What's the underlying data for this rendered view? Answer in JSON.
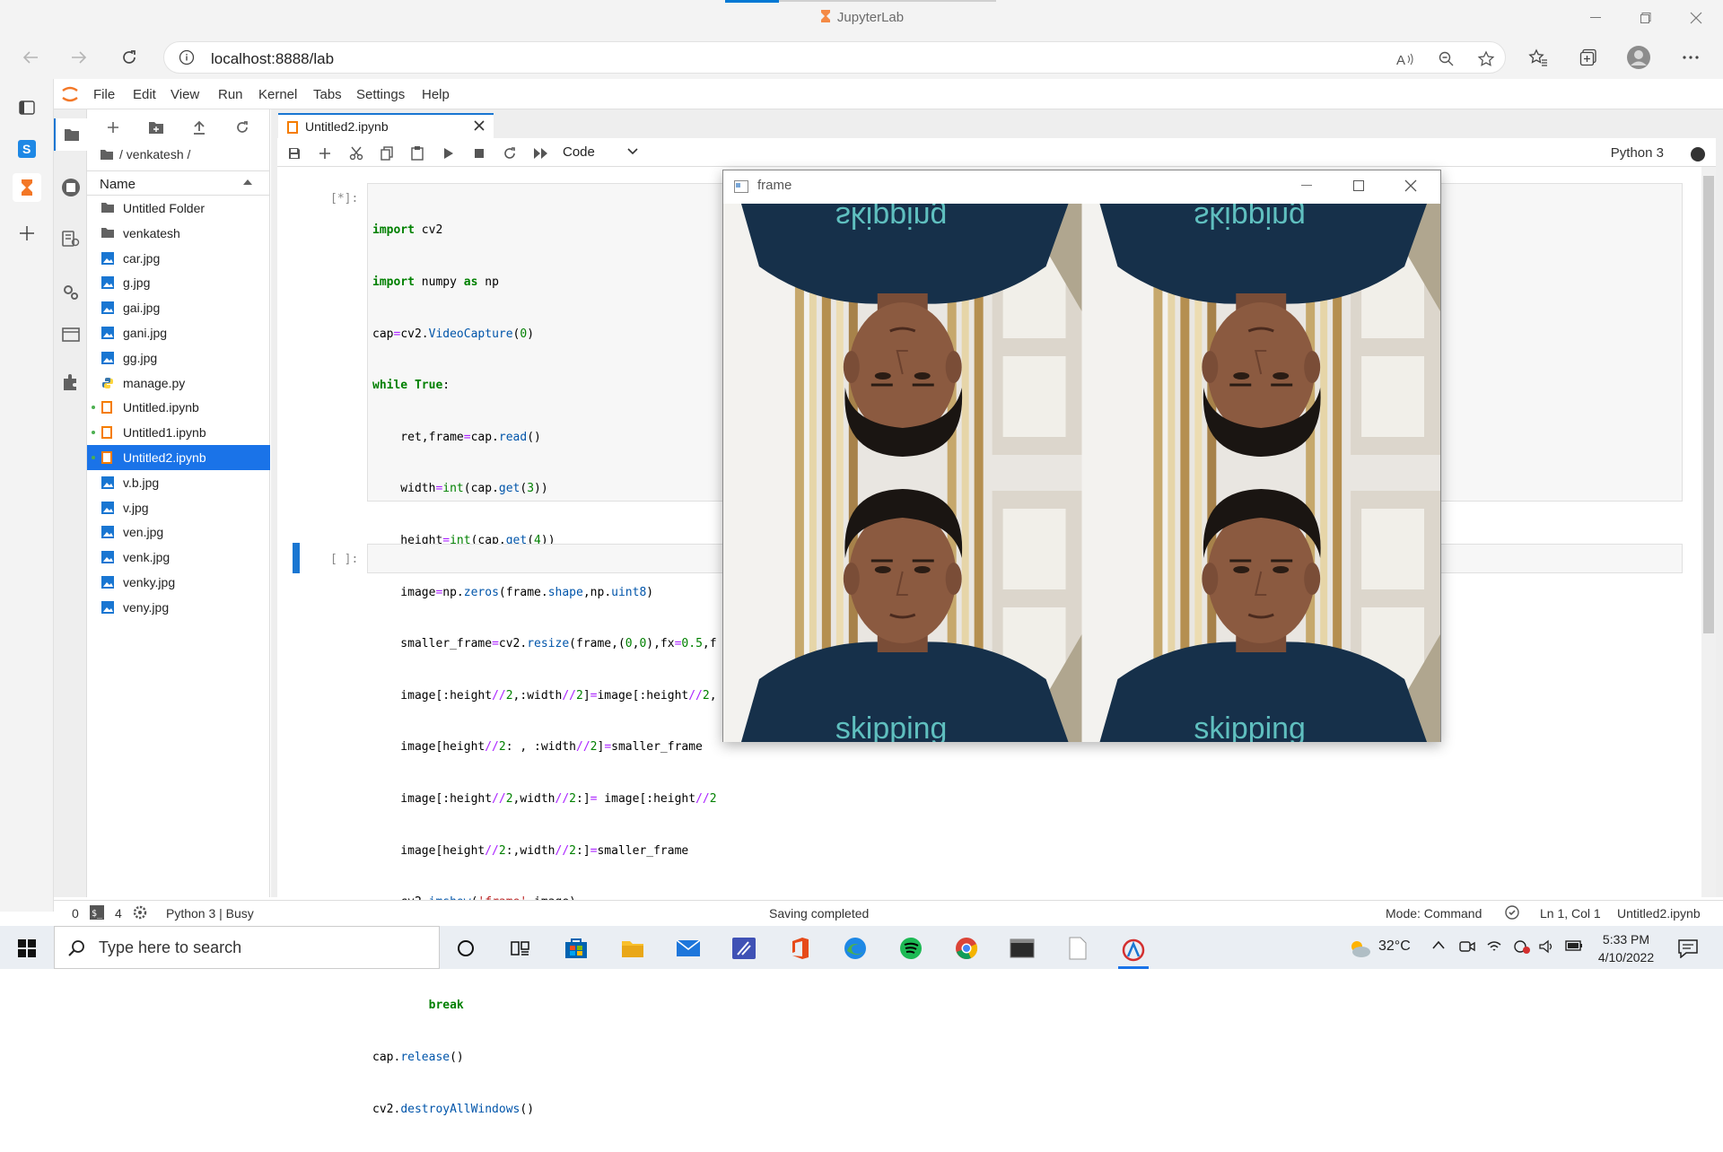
{
  "browser": {
    "window_title": "JupyterLab",
    "url": "localhost:8888/lab"
  },
  "jupyter": {
    "menu": [
      "File",
      "Edit",
      "View",
      "Run",
      "Kernel",
      "Tabs",
      "Settings",
      "Help"
    ],
    "breadcrumb": "/ venkatesh /",
    "file_header": "Name",
    "files": [
      {
        "name": "Untitled Folder",
        "type": "folder",
        "running": false,
        "selected": false
      },
      {
        "name": "venkatesh",
        "type": "folder",
        "running": false,
        "selected": false
      },
      {
        "name": "car.jpg",
        "type": "image",
        "running": false,
        "selected": false
      },
      {
        "name": "g.jpg",
        "type": "image",
        "running": false,
        "selected": false
      },
      {
        "name": "gai.jpg",
        "type": "image",
        "running": false,
        "selected": false
      },
      {
        "name": "gani.jpg",
        "type": "image",
        "running": false,
        "selected": false
      },
      {
        "name": "gg.jpg",
        "type": "image",
        "running": false,
        "selected": false
      },
      {
        "name": "manage.py",
        "type": "python",
        "running": false,
        "selected": false
      },
      {
        "name": "Untitled.ipynb",
        "type": "notebook",
        "running": true,
        "selected": false
      },
      {
        "name": "Untitled1.ipynb",
        "type": "notebook",
        "running": true,
        "selected": false
      },
      {
        "name": "Untitled2.ipynb",
        "type": "notebook",
        "running": true,
        "selected": true
      },
      {
        "name": "v.b.jpg",
        "type": "image",
        "running": false,
        "selected": false
      },
      {
        "name": "v.jpg",
        "type": "image",
        "running": false,
        "selected": false
      },
      {
        "name": "ven.jpg",
        "type": "image",
        "running": false,
        "selected": false
      },
      {
        "name": "venk.jpg",
        "type": "image",
        "running": false,
        "selected": false
      },
      {
        "name": "venky.jpg",
        "type": "image",
        "running": false,
        "selected": false
      },
      {
        "name": "veny.jpg",
        "type": "image",
        "running": false,
        "selected": false
      }
    ],
    "tab_label": "Untitled2.ipynb",
    "cell_type": "Code",
    "kernel": "Python 3",
    "cell1_prompt": "[*]:",
    "cell2_prompt": "[ ]:",
    "code_lines": [
      "import cv2",
      "import numpy as np",
      "cap=cv2.VideoCapture(0)",
      "while True:",
      "    ret,frame=cap.read()",
      "    width=int(cap.get(3))",
      "    height=int(cap.get(4))",
      "    image=np.zeros(frame.shape,np.uint8)",
      "    smaller_frame=cv2.resize(frame,(0,0),fx=0.5,f",
      "    image[:height//2,:width//2]=image[:height//2,",
      "    image[height//2: , :width//2]=smaller_frame",
      "    image[:height//2,width//2:]= image[:height//2",
      "    image[height//2:,width//2:]=smaller_frame",
      "    cv2.imshow('frame',image)",
      "    if cv2.waitKey(1)==ord('q'):",
      "        break",
      "cap.release()",
      "cv2.destroyAllWindows()"
    ]
  },
  "statusbar": {
    "terminals": "0",
    "kernels": "4",
    "kernel_status": "Python 3 | Busy",
    "message": "Saving completed",
    "mode": "Mode: Command",
    "cursor": "Ln 1, Col 1",
    "file": "Untitled2.ipynb"
  },
  "cv_window": {
    "title": "frame"
  },
  "taskbar": {
    "search_placeholder": "Type here to search",
    "temperature": "32°C",
    "time": "5:33 PM",
    "date": "4/10/2022"
  },
  "colors": {
    "accent": "#1976d2",
    "selection": "#1a73e8",
    "jupyter_orange": "#f37726"
  }
}
